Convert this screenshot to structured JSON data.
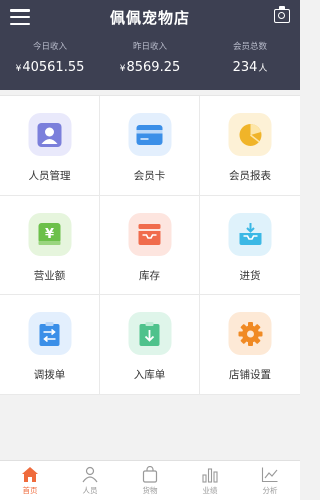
{
  "header": {
    "title": "佩佩宠物店",
    "menu_icon": "menu-icon",
    "scan_icon": "camera-icon",
    "bg_color": "#3d4052"
  },
  "stats": [
    {
      "label": "今日收入",
      "currency": "¥",
      "value": "40561.55",
      "unit": ""
    },
    {
      "label": "昨日收入",
      "currency": "¥",
      "value": "8569.25",
      "unit": ""
    },
    {
      "label": "会员总数",
      "currency": "",
      "value": "234",
      "unit": "人"
    }
  ],
  "grid": [
    {
      "label": "人员管理",
      "icon": "user-icon",
      "color": "#7b7fdb",
      "bg": "#e9e9fb"
    },
    {
      "label": "会员卡",
      "icon": "card-icon",
      "color": "#3b8fe8",
      "bg": "#e3effd"
    },
    {
      "label": "会员报表",
      "icon": "pie-chart-icon",
      "color": "#f0b429",
      "bg": "#fdf1d6"
    },
    {
      "label": "营业额",
      "icon": "money-icon",
      "color": "#6cc04a",
      "bg": "#e6f5dd"
    },
    {
      "label": "库存",
      "icon": "inbox-icon",
      "color": "#f06b4c",
      "bg": "#fde5df"
    },
    {
      "label": "进货",
      "icon": "tray-download-icon",
      "color": "#3bb8e5",
      "bg": "#dff2fb"
    },
    {
      "label": "调拨单",
      "icon": "transfer-clipboard-icon",
      "color": "#3b8fe8",
      "bg": "#e3effd"
    },
    {
      "label": "入库单",
      "icon": "download-clipboard-icon",
      "color": "#4fc28c",
      "bg": "#dff5ea"
    },
    {
      "label": "店铺设置",
      "icon": "gear-icon",
      "color": "#f08a24",
      "bg": "#fde9d6"
    }
  ],
  "nav": [
    {
      "label": "首页",
      "icon": "home-icon",
      "active": true
    },
    {
      "label": "人员",
      "icon": "person-icon",
      "active": false
    },
    {
      "label": "货物",
      "icon": "bag-icon",
      "active": false
    },
    {
      "label": "业绩",
      "icon": "bar-chart-icon",
      "active": false
    },
    {
      "label": "分析",
      "icon": "line-chart-icon",
      "active": false
    }
  ],
  "accent_color": "#ef6b3c"
}
